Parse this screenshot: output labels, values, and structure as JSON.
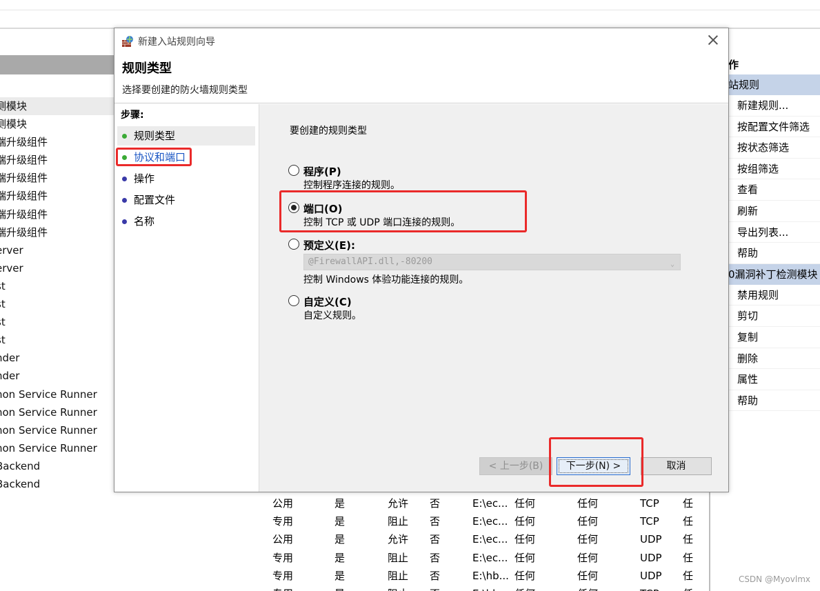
{
  "background": {
    "left_items": [
      "测模块",
      "测模块",
      "端升级组件",
      "端升级组件",
      "端升级组件",
      "端升级组件",
      "端升级组件",
      "端升级组件",
      "erver",
      "erver",
      "st",
      "st",
      "st",
      "st",
      "nder",
      "nder",
      "hon Service Runner",
      "hon Service Runner",
      "hon Service Runner",
      "hon Service Runner",
      " Backend",
      " Backend"
    ],
    "table_rows": [
      [
        "公用",
        "是",
        "允许",
        "否",
        "E:\\ec...",
        "任何",
        "任何",
        "TCP",
        "任"
      ],
      [
        "专用",
        "是",
        "阻止",
        "否",
        "E:\\ec...",
        "任何",
        "任何",
        "TCP",
        "任"
      ],
      [
        "公用",
        "是",
        "允许",
        "否",
        "E:\\ec...",
        "任何",
        "任何",
        "UDP",
        "任"
      ],
      [
        "专用",
        "是",
        "阻止",
        "否",
        "E:\\ec...",
        "任何",
        "任何",
        "UDP",
        "任"
      ],
      [
        "专用",
        "是",
        "阻止",
        "否",
        "E:\\hb...",
        "任何",
        "任何",
        "UDP",
        "任"
      ],
      [
        "专用",
        "是",
        "阻止",
        "否",
        "E:\\hb...",
        "任何",
        "任何",
        "TCP",
        "任"
      ]
    ],
    "actions": {
      "title": "作",
      "section1": "站规则",
      "section1_items": [
        "新建规则...",
        "按配置文件筛选",
        "按状态筛选",
        "按组筛选",
        "查看",
        "刷新",
        "导出列表...",
        "帮助"
      ],
      "section2": "0漏洞补丁检测模块",
      "section2_items": [
        "禁用规则",
        "剪切",
        "复制",
        "删除",
        "属性",
        "帮助"
      ]
    },
    "watermark": "CSDN @Myovlmx"
  },
  "dialog": {
    "title": "新建入站规则向导",
    "heading": "规则类型",
    "subheading": "选择要创建的防火墙规则类型",
    "steps_title": "步骤:",
    "steps": [
      {
        "label": "规则类型",
        "dot": "#3aaa35"
      },
      {
        "label": "协议和端口",
        "dot": "#3aaa35"
      },
      {
        "label": "操作",
        "dot": "#3a3aa8"
      },
      {
        "label": "配置文件",
        "dot": "#3a3aa8"
      },
      {
        "label": "名称",
        "dot": "#3a3aa8"
      }
    ],
    "question": "要创建的规则类型",
    "options": [
      {
        "label": "程序(P)",
        "desc": "控制程序连接的规则。",
        "selected": false
      },
      {
        "label": "端口(O)",
        "desc": "控制 TCP 或 UDP 端口连接的规则。",
        "selected": true
      },
      {
        "label": "预定义(E):",
        "desc": "控制 Windows 体验功能连接的规则。",
        "selected": false
      },
      {
        "label": "自定义(C)",
        "desc": "自定义规则。",
        "selected": false
      }
    ],
    "predefined_value": "@FirewallAPI.dll,-80200",
    "buttons": {
      "back": "< 上一步(B)",
      "next": "下一步(N) >",
      "cancel": "取消"
    },
    "highlight_color": "#ea2a2a"
  }
}
